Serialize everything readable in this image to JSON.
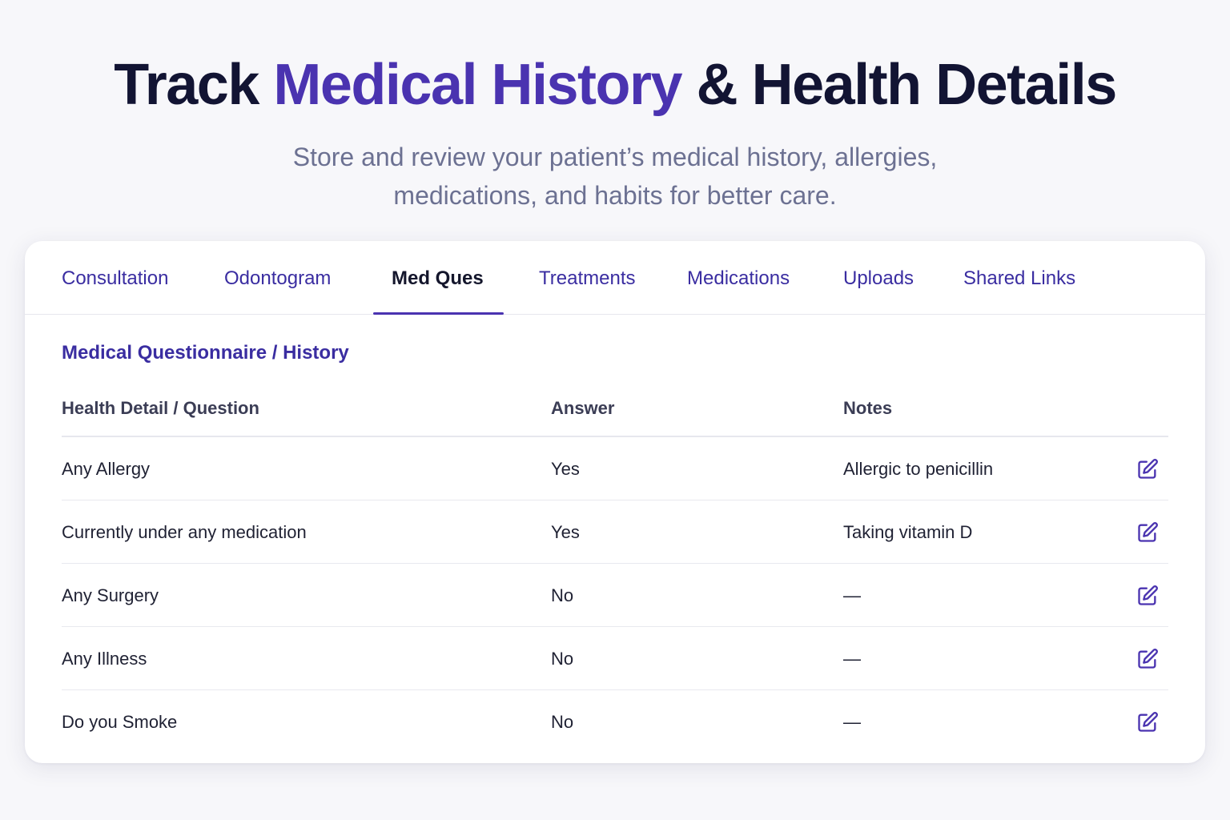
{
  "hero": {
    "title_part1": "Track ",
    "title_accent": "Medical History",
    "title_part2": " & Health Details",
    "subtitle": "Store and review your patient’s medical history, allergies, medications, and habits for better care."
  },
  "tabs": [
    {
      "label": "Consultation",
      "active": false
    },
    {
      "label": "Odontogram",
      "active": false
    },
    {
      "label": "Med Ques",
      "active": true
    },
    {
      "label": "Treatments",
      "active": false
    },
    {
      "label": "Medications",
      "active": false
    },
    {
      "label": "Uploads",
      "active": false
    },
    {
      "label": "Shared Links",
      "active": false
    }
  ],
  "section_title": "Medical Questionnaire / History",
  "table": {
    "headers": [
      "Health Detail / Question",
      "Answer",
      "Notes"
    ],
    "rows": [
      {
        "question": "Any Allergy",
        "answer": "Yes",
        "notes": "Allergic to penicillin",
        "action_icon": "edit-icon"
      },
      {
        "question": "Currently under any medication",
        "answer": "Yes",
        "notes": "Taking vitamin D",
        "action_icon": "edit-icon"
      },
      {
        "question": "Any Surgery",
        "answer": "No",
        "notes": "—",
        "action_icon": "edit-icon"
      },
      {
        "question": "Any Illness",
        "answer": "No",
        "notes": "—",
        "action_icon": "edit-icon"
      },
      {
        "question": "Do you Smoke",
        "answer": "No",
        "notes": "—",
        "action_icon": "edit-icon"
      }
    ]
  },
  "colors": {
    "accent": "#4a33b0",
    "title": "#121433",
    "subtitle": "#6c7192",
    "tab_text": "#3a2da1",
    "background": "#f7f7fa",
    "card": "#ffffff"
  }
}
